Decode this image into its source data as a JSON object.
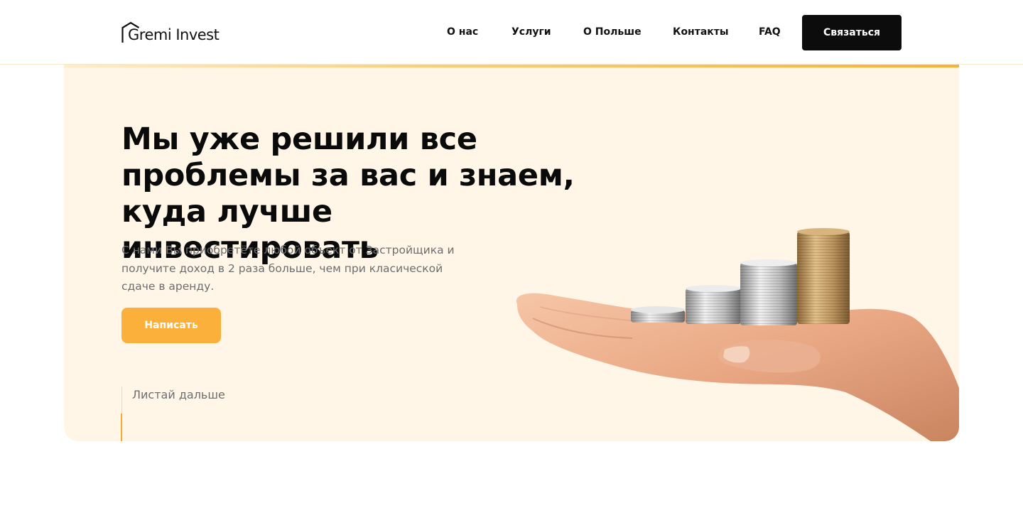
{
  "header": {
    "logo_text": "Gremi Invest",
    "nav": [
      "О нас",
      "Услуги",
      "О Польше",
      "Контакты",
      "FAQ"
    ],
    "contact_button": "Связаться"
  },
  "hero": {
    "title": "Мы уже решили все проблемы за вас и знаем, куда лучше инвестировать",
    "subtitle": "С нами Вы приобретёте любой объект от Застройщика и получите доход в 2 раза больше, чем при класической сдаче в аренду.",
    "button": "Написать",
    "scroll_label": "Листай дальше",
    "image": "hand-with-coin-stacks"
  },
  "colors": {
    "accent": "#fbb03b",
    "hero_background": "#fff6e8",
    "dark_button": "#0c0c0c",
    "text_muted": "#6d6d6d"
  }
}
